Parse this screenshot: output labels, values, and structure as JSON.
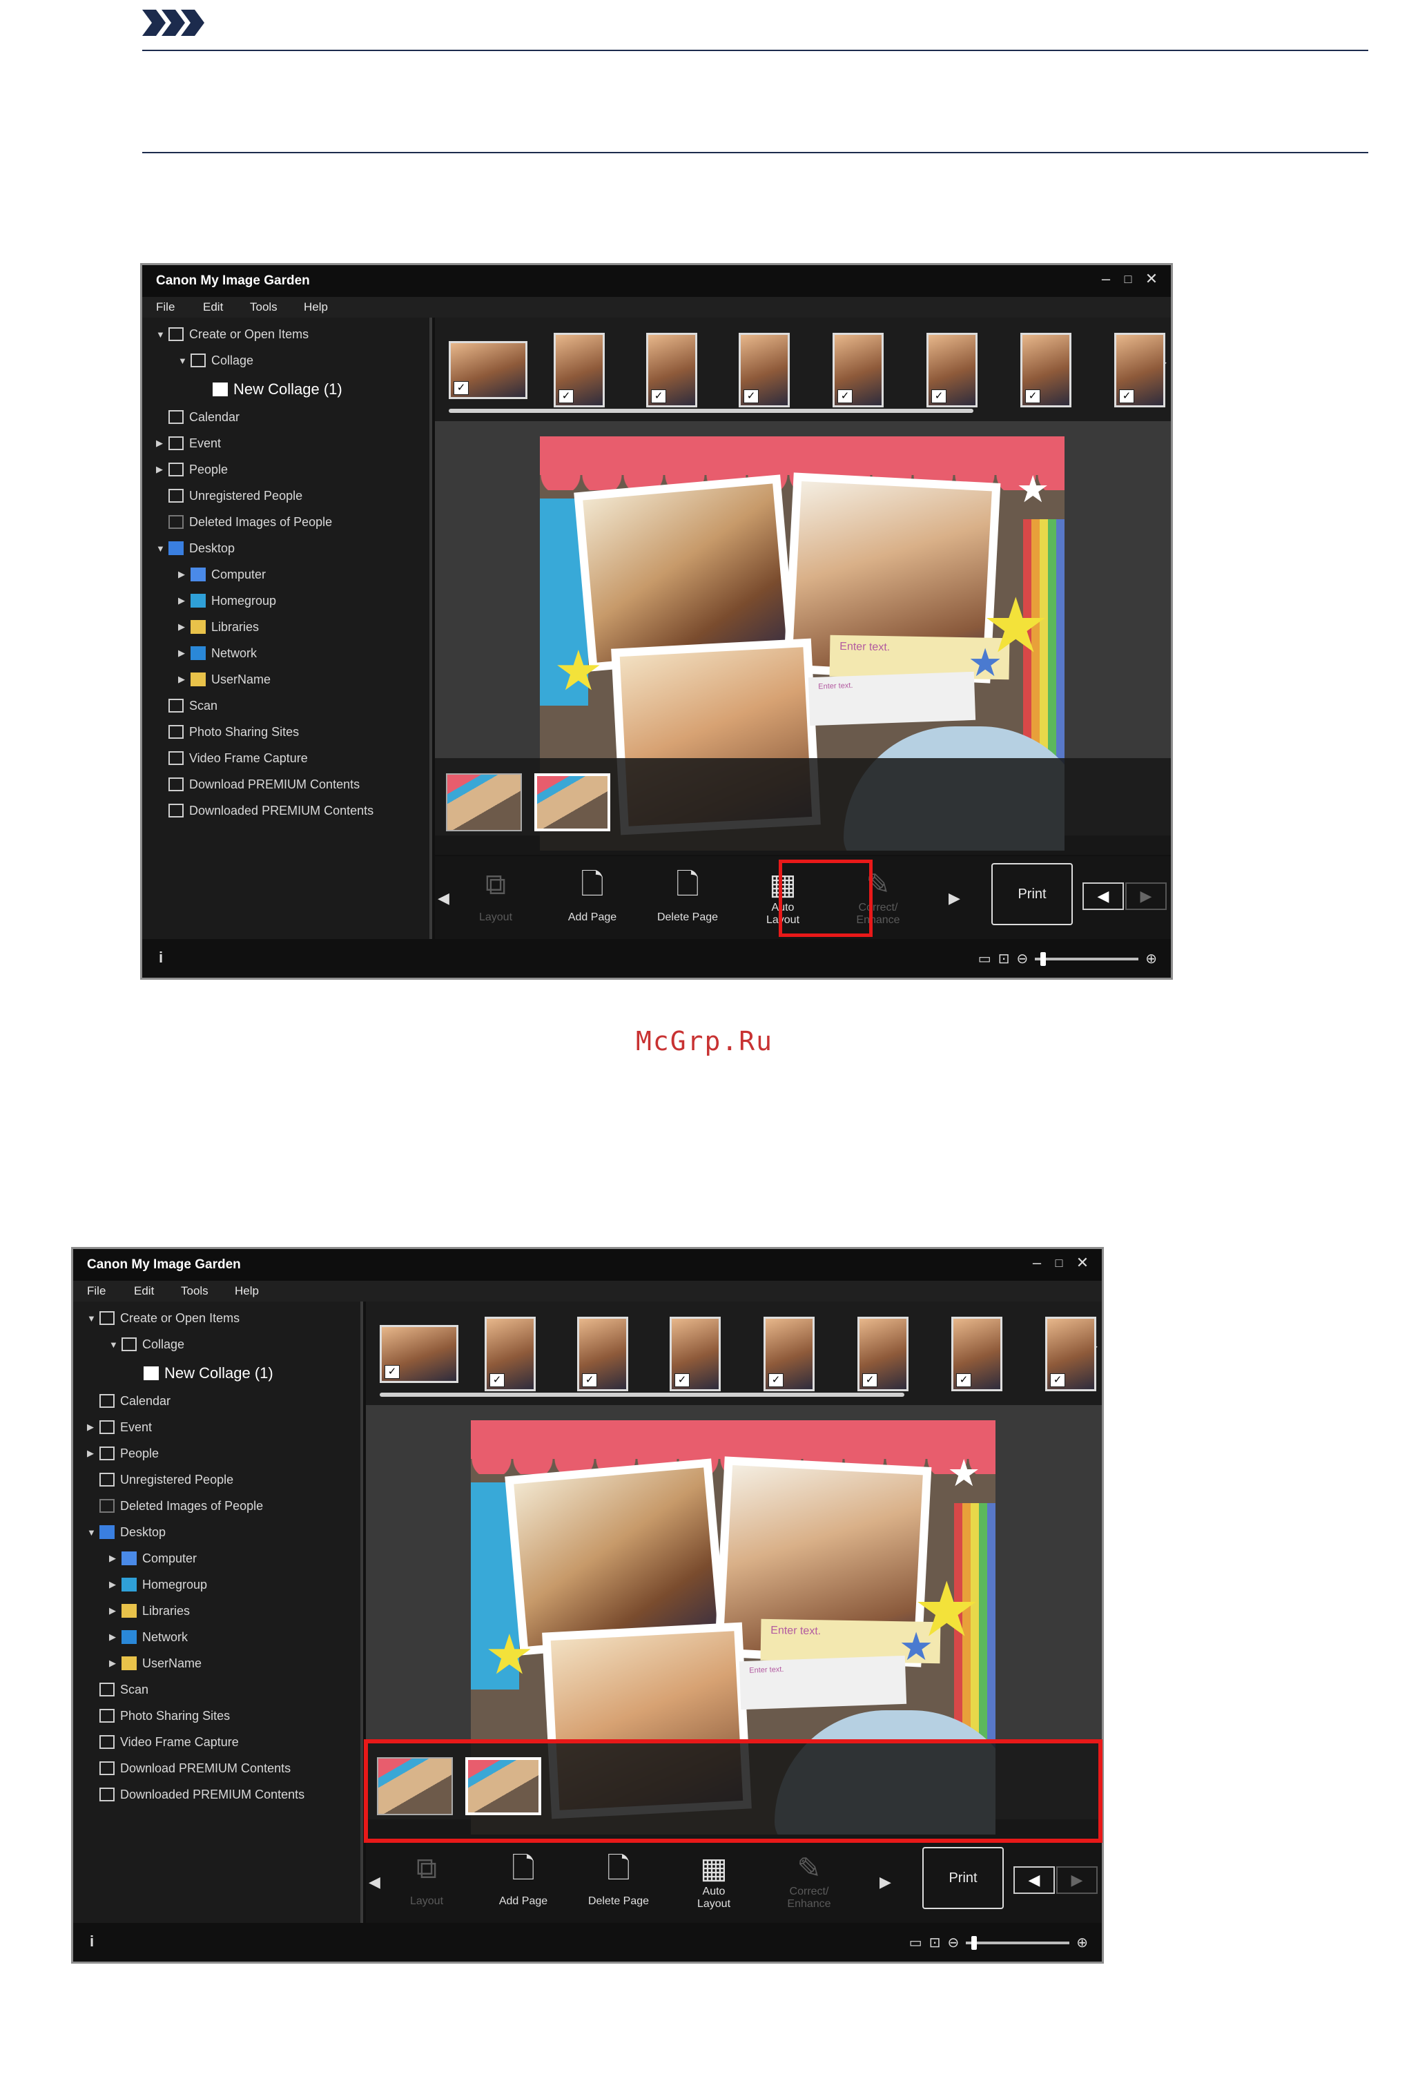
{
  "watermark": "McGrp.Ru",
  "app": {
    "title": "Canon My Image Garden",
    "menu": [
      "File",
      "Edit",
      "Tools",
      "Help"
    ],
    "tree": [
      {
        "label": "Create or Open Items",
        "indent": 0,
        "arrow": "▼",
        "icon": "create-icon"
      },
      {
        "label": "Collage",
        "indent": 1,
        "arrow": "▼",
        "icon": "collage-icon"
      },
      {
        "label": "New Collage (1)",
        "indent": 2,
        "arrow": "",
        "icon": "new-collage-icon",
        "selected": true
      },
      {
        "label": "Calendar",
        "indent": 0,
        "arrow": "",
        "icon": "calendar-icon"
      },
      {
        "label": "Event",
        "indent": 0,
        "arrow": "▶",
        "icon": "event-icon"
      },
      {
        "label": "People",
        "indent": 0,
        "arrow": "▶",
        "icon": "people-icon"
      },
      {
        "label": "Unregistered People",
        "indent": 0,
        "arrow": "",
        "icon": "unregistered-people-icon"
      },
      {
        "label": "Deleted Images of People",
        "indent": 0,
        "arrow": "",
        "icon": "deleted-people-icon"
      },
      {
        "label": "Desktop",
        "indent": 0,
        "arrow": "▼",
        "icon": "desktop-icon"
      },
      {
        "label": "Computer",
        "indent": 1,
        "arrow": "▶",
        "icon": "computer-icon"
      },
      {
        "label": "Homegroup",
        "indent": 1,
        "arrow": "▶",
        "icon": "homegroup-icon"
      },
      {
        "label": "Libraries",
        "indent": 1,
        "arrow": "▶",
        "icon": "libraries-icon"
      },
      {
        "label": "Network",
        "indent": 1,
        "arrow": "▶",
        "icon": "network-icon"
      },
      {
        "label": "UserName",
        "indent": 1,
        "arrow": "▶",
        "icon": "user-folder-icon"
      },
      {
        "label": "Scan",
        "indent": 0,
        "arrow": "",
        "icon": "scan-icon"
      },
      {
        "label": "Photo Sharing Sites",
        "indent": 0,
        "arrow": "",
        "icon": "photo-sharing-icon"
      },
      {
        "label": "Video Frame Capture",
        "indent": 0,
        "arrow": "",
        "icon": "video-frame-icon"
      },
      {
        "label": "Download PREMIUM Contents",
        "indent": 0,
        "arrow": "",
        "icon": "download-premium-icon"
      },
      {
        "label": "Downloaded PREMIUM Contents",
        "indent": 0,
        "arrow": "",
        "icon": "downloaded-premium-icon"
      }
    ],
    "canvas_text": {
      "enter_text": "Enter text.",
      "enter_text_small": "Enter text."
    },
    "toolbar": {
      "layout": "Layout",
      "add_page": "Add Page",
      "delete_page": "Delete Page",
      "auto_layout_line1": "Auto",
      "auto_layout_line2": "Layout",
      "correct_line1": "Correct/",
      "correct_line2": "Enhance",
      "print": "Print"
    },
    "colors": {
      "highlight": "#e81919",
      "window_bg": "#111111"
    }
  }
}
